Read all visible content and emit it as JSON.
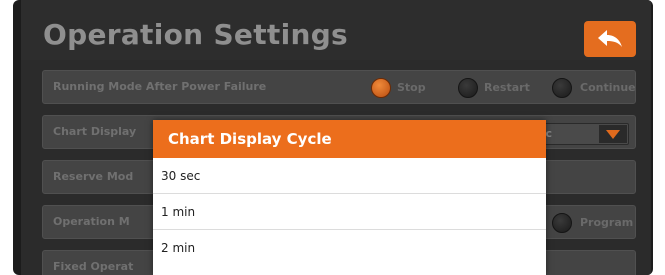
{
  "header": {
    "title": "Operation Settings",
    "back_icon": "back-arrow-icon"
  },
  "settings": {
    "running_mode": {
      "label": "Running Mode After Power Failure",
      "options": [
        "Stop",
        "Restart",
        "Continue"
      ],
      "selected": "Stop"
    },
    "chart_display": {
      "label": "Chart Display Cycle",
      "label_visible": "Chart Display",
      "value_visible": "ec"
    },
    "reserve_mode": {
      "label_visible": "Reserve Mod"
    },
    "operation_mode": {
      "label_visible": "Operation M",
      "option_visible": "Program"
    },
    "fixed_operation": {
      "label_visible": "Fixed Operat"
    }
  },
  "dialog": {
    "title": "Chart Display Cycle",
    "options": [
      "30 sec",
      "1 min",
      "2 min"
    ]
  },
  "colors": {
    "accent": "#ec6e1c",
    "background": "#2b2b2b",
    "row": "#444444"
  }
}
